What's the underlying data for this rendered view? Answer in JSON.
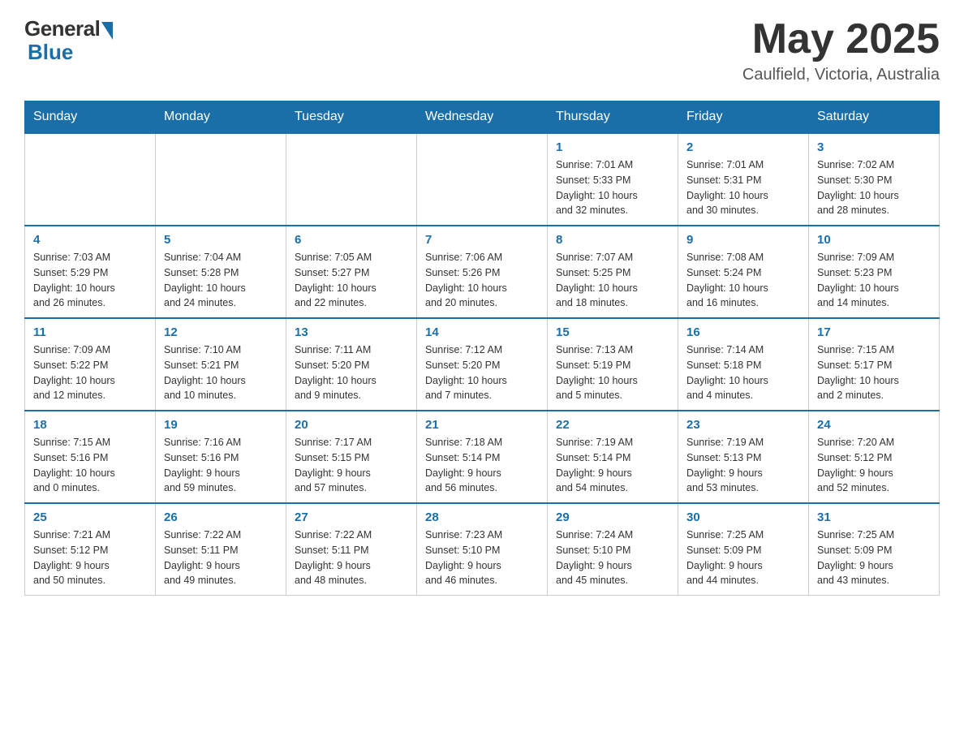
{
  "header": {
    "logo_general": "General",
    "logo_blue": "Blue",
    "month_year": "May 2025",
    "location": "Caulfield, Victoria, Australia"
  },
  "weekdays": [
    "Sunday",
    "Monday",
    "Tuesday",
    "Wednesday",
    "Thursday",
    "Friday",
    "Saturday"
  ],
  "weeks": [
    [
      {
        "day": "",
        "info": ""
      },
      {
        "day": "",
        "info": ""
      },
      {
        "day": "",
        "info": ""
      },
      {
        "day": "",
        "info": ""
      },
      {
        "day": "1",
        "info": "Sunrise: 7:01 AM\nSunset: 5:33 PM\nDaylight: 10 hours\nand 32 minutes."
      },
      {
        "day": "2",
        "info": "Sunrise: 7:01 AM\nSunset: 5:31 PM\nDaylight: 10 hours\nand 30 minutes."
      },
      {
        "day": "3",
        "info": "Sunrise: 7:02 AM\nSunset: 5:30 PM\nDaylight: 10 hours\nand 28 minutes."
      }
    ],
    [
      {
        "day": "4",
        "info": "Sunrise: 7:03 AM\nSunset: 5:29 PM\nDaylight: 10 hours\nand 26 minutes."
      },
      {
        "day": "5",
        "info": "Sunrise: 7:04 AM\nSunset: 5:28 PM\nDaylight: 10 hours\nand 24 minutes."
      },
      {
        "day": "6",
        "info": "Sunrise: 7:05 AM\nSunset: 5:27 PM\nDaylight: 10 hours\nand 22 minutes."
      },
      {
        "day": "7",
        "info": "Sunrise: 7:06 AM\nSunset: 5:26 PM\nDaylight: 10 hours\nand 20 minutes."
      },
      {
        "day": "8",
        "info": "Sunrise: 7:07 AM\nSunset: 5:25 PM\nDaylight: 10 hours\nand 18 minutes."
      },
      {
        "day": "9",
        "info": "Sunrise: 7:08 AM\nSunset: 5:24 PM\nDaylight: 10 hours\nand 16 minutes."
      },
      {
        "day": "10",
        "info": "Sunrise: 7:09 AM\nSunset: 5:23 PM\nDaylight: 10 hours\nand 14 minutes."
      }
    ],
    [
      {
        "day": "11",
        "info": "Sunrise: 7:09 AM\nSunset: 5:22 PM\nDaylight: 10 hours\nand 12 minutes."
      },
      {
        "day": "12",
        "info": "Sunrise: 7:10 AM\nSunset: 5:21 PM\nDaylight: 10 hours\nand 10 minutes."
      },
      {
        "day": "13",
        "info": "Sunrise: 7:11 AM\nSunset: 5:20 PM\nDaylight: 10 hours\nand 9 minutes."
      },
      {
        "day": "14",
        "info": "Sunrise: 7:12 AM\nSunset: 5:20 PM\nDaylight: 10 hours\nand 7 minutes."
      },
      {
        "day": "15",
        "info": "Sunrise: 7:13 AM\nSunset: 5:19 PM\nDaylight: 10 hours\nand 5 minutes."
      },
      {
        "day": "16",
        "info": "Sunrise: 7:14 AM\nSunset: 5:18 PM\nDaylight: 10 hours\nand 4 minutes."
      },
      {
        "day": "17",
        "info": "Sunrise: 7:15 AM\nSunset: 5:17 PM\nDaylight: 10 hours\nand 2 minutes."
      }
    ],
    [
      {
        "day": "18",
        "info": "Sunrise: 7:15 AM\nSunset: 5:16 PM\nDaylight: 10 hours\nand 0 minutes."
      },
      {
        "day": "19",
        "info": "Sunrise: 7:16 AM\nSunset: 5:16 PM\nDaylight: 9 hours\nand 59 minutes."
      },
      {
        "day": "20",
        "info": "Sunrise: 7:17 AM\nSunset: 5:15 PM\nDaylight: 9 hours\nand 57 minutes."
      },
      {
        "day": "21",
        "info": "Sunrise: 7:18 AM\nSunset: 5:14 PM\nDaylight: 9 hours\nand 56 minutes."
      },
      {
        "day": "22",
        "info": "Sunrise: 7:19 AM\nSunset: 5:14 PM\nDaylight: 9 hours\nand 54 minutes."
      },
      {
        "day": "23",
        "info": "Sunrise: 7:19 AM\nSunset: 5:13 PM\nDaylight: 9 hours\nand 53 minutes."
      },
      {
        "day": "24",
        "info": "Sunrise: 7:20 AM\nSunset: 5:12 PM\nDaylight: 9 hours\nand 52 minutes."
      }
    ],
    [
      {
        "day": "25",
        "info": "Sunrise: 7:21 AM\nSunset: 5:12 PM\nDaylight: 9 hours\nand 50 minutes."
      },
      {
        "day": "26",
        "info": "Sunrise: 7:22 AM\nSunset: 5:11 PM\nDaylight: 9 hours\nand 49 minutes."
      },
      {
        "day": "27",
        "info": "Sunrise: 7:22 AM\nSunset: 5:11 PM\nDaylight: 9 hours\nand 48 minutes."
      },
      {
        "day": "28",
        "info": "Sunrise: 7:23 AM\nSunset: 5:10 PM\nDaylight: 9 hours\nand 46 minutes."
      },
      {
        "day": "29",
        "info": "Sunrise: 7:24 AM\nSunset: 5:10 PM\nDaylight: 9 hours\nand 45 minutes."
      },
      {
        "day": "30",
        "info": "Sunrise: 7:25 AM\nSunset: 5:09 PM\nDaylight: 9 hours\nand 44 minutes."
      },
      {
        "day": "31",
        "info": "Sunrise: 7:25 AM\nSunset: 5:09 PM\nDaylight: 9 hours\nand 43 minutes."
      }
    ]
  ]
}
